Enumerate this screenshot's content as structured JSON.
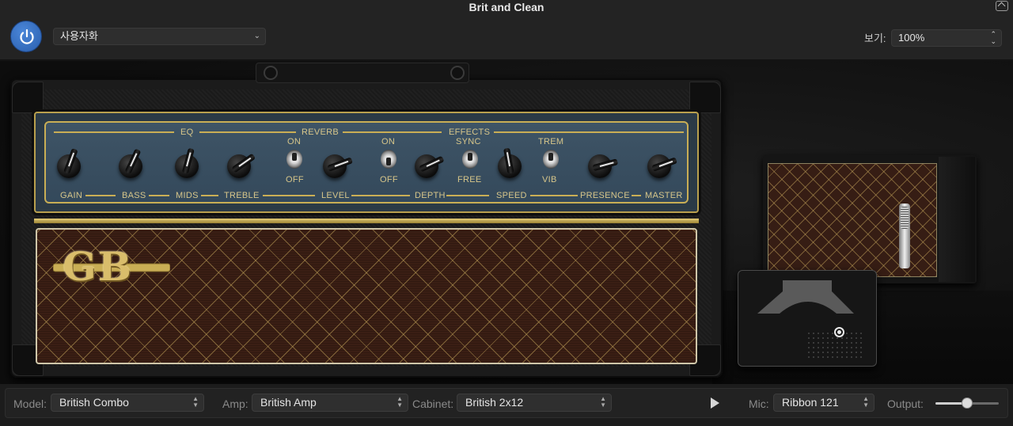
{
  "window": {
    "title": "Brit and Clean"
  },
  "header": {
    "preset": "사용자화",
    "view_label": "보기:",
    "zoom": "100%"
  },
  "amp_panel": {
    "sections": {
      "eq": "EQ",
      "reverb": "REVERB",
      "effects": "EFFECTS"
    },
    "controls": {
      "gain": "GAIN",
      "bass": "BASS",
      "mids": "MIDS",
      "treble": "TREBLE",
      "level": "LEVEL",
      "depth": "DEPTH",
      "speed": "SPEED",
      "presence": "PRESENCE",
      "master": "MASTER"
    },
    "switches": {
      "reverb_on": "ON",
      "reverb_off": "OFF",
      "effects_on": "ON",
      "effects_off": "OFF",
      "sync": "SYNC",
      "free": "FREE",
      "trem": "TREM",
      "vib": "VIB"
    },
    "logo": "GB"
  },
  "toolbar": {
    "model_label": "Model:",
    "model_value": "British Combo",
    "amp_label": "Amp:",
    "amp_value": "British Amp",
    "cabinet_label": "Cabinet:",
    "cabinet_value": "British 2x12",
    "mic_label": "Mic:",
    "mic_value": "Ribbon 121",
    "output_label": "Output:",
    "output_level": 0.5
  },
  "colors": {
    "accent_blue": "#3a73c8",
    "panel_blue": "#3e5466",
    "gold": "#c9ae55",
    "grill_brown": "#3a1e14"
  },
  "icons": {
    "power": "power-icon",
    "play": "play-icon",
    "popup": "chevron-down-icon",
    "stepper": "up-down-chevron-icon"
  }
}
